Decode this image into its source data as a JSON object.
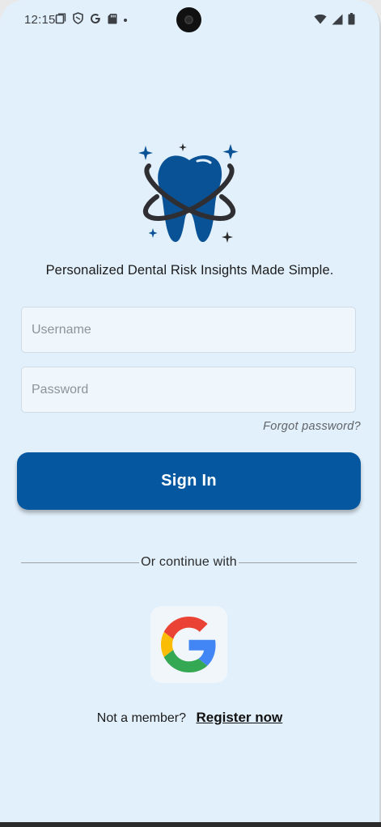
{
  "status_bar": {
    "time": "12:15",
    "left_icons": [
      "screen-record-icon",
      "shield-icon",
      "google-icon",
      "sd-card-icon",
      "dot-icon"
    ],
    "right_icons": [
      "wifi-icon",
      "signal-icon",
      "battery-icon"
    ]
  },
  "branding": {
    "logo_icon": "tooth-logo-icon",
    "tagline": "Personalized Dental Risk Insights Made Simple."
  },
  "login_form": {
    "username_placeholder": "Username",
    "username_value": "",
    "password_placeholder": "Password",
    "password_value": "",
    "forgot_password_label": "Forgot password?",
    "sign_in_label": "Sign In"
  },
  "alternate_login": {
    "divider_text": "Or continue with",
    "google_icon": "google-logo-icon"
  },
  "register": {
    "prompt": "Not a member?",
    "link_label": "Register now"
  },
  "colors": {
    "background": "#e2f0fb",
    "primary": "#0558a0",
    "field_background": "#eff7fd"
  }
}
